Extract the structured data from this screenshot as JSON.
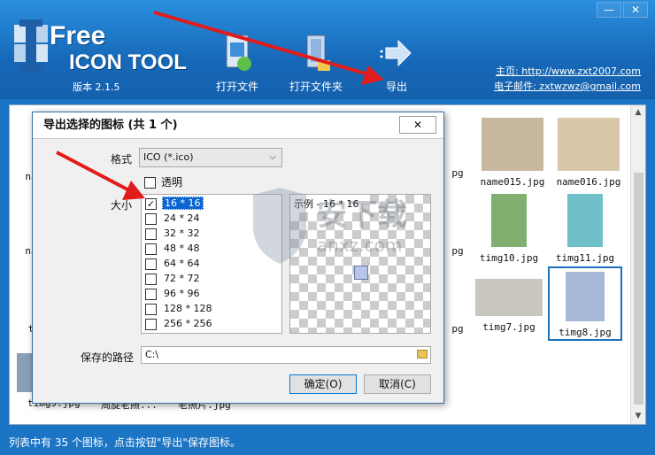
{
  "app": {
    "logo_free": "Free",
    "logo_tool": "ICON TOOL",
    "version": "版本 2.1.5",
    "homepage": "主页: http://www.zxt2007.com",
    "email": "电子邮件: zxtwzwz@gmail.com",
    "win_controls": [
      "—",
      "✕"
    ]
  },
  "toolbar": {
    "open_file": "打开文件",
    "open_folder": "打开文件夹",
    "export": "导出"
  },
  "thumbnails": [
    {
      "name": "name015.jpg",
      "color": "#c8b8a0"
    },
    {
      "name": "name016.jpg",
      "color": "#d8c8a8"
    },
    {
      "name": "timg10.jpg",
      "color": "#7fb070"
    },
    {
      "name": "timg11.jpg",
      "color": "#6fc0c8"
    },
    {
      "name": "timg7.jpg",
      "color": "#c9c6c0"
    },
    {
      "name": "timg8.jpg",
      "color": "#a8b8d8"
    },
    {
      "name": "timg9.jpg",
      "color": "#8aa0b8"
    },
    {
      "name": "周旋老照...",
      "color": "#999"
    },
    {
      "name": "老照片.jpg",
      "color": "#aaa"
    }
  ],
  "partial_labels": [
    "na",
    "na",
    "t",
    "pg",
    "pg",
    "pg"
  ],
  "dialog": {
    "title": "导出选择的图标 (共 1 个)",
    "close": "✕",
    "format_label": "格式",
    "format_value": "ICO (*.ico)",
    "transparent_label": "透明",
    "size_label": "大小",
    "sizes": [
      {
        "label": "16 * 16",
        "checked": true
      },
      {
        "label": "24 * 24",
        "checked": false
      },
      {
        "label": "32 * 32",
        "checked": false
      },
      {
        "label": "48 * 48",
        "checked": false
      },
      {
        "label": "64 * 64",
        "checked": false
      },
      {
        "label": "72 * 72",
        "checked": false
      },
      {
        "label": "96 * 96",
        "checked": false
      },
      {
        "label": "128 * 128",
        "checked": false
      },
      {
        "label": "256 * 256",
        "checked": false
      }
    ],
    "preview_caption": "示例 - 16 * 16",
    "path_label": "保存的路径",
    "path_value": "C:\\",
    "ok": "确定(O)",
    "cancel": "取消(C)"
  },
  "status": "列表中有 35 个图标，点击按钮\"导出\"保存图标。",
  "watermark": "anxz.com"
}
